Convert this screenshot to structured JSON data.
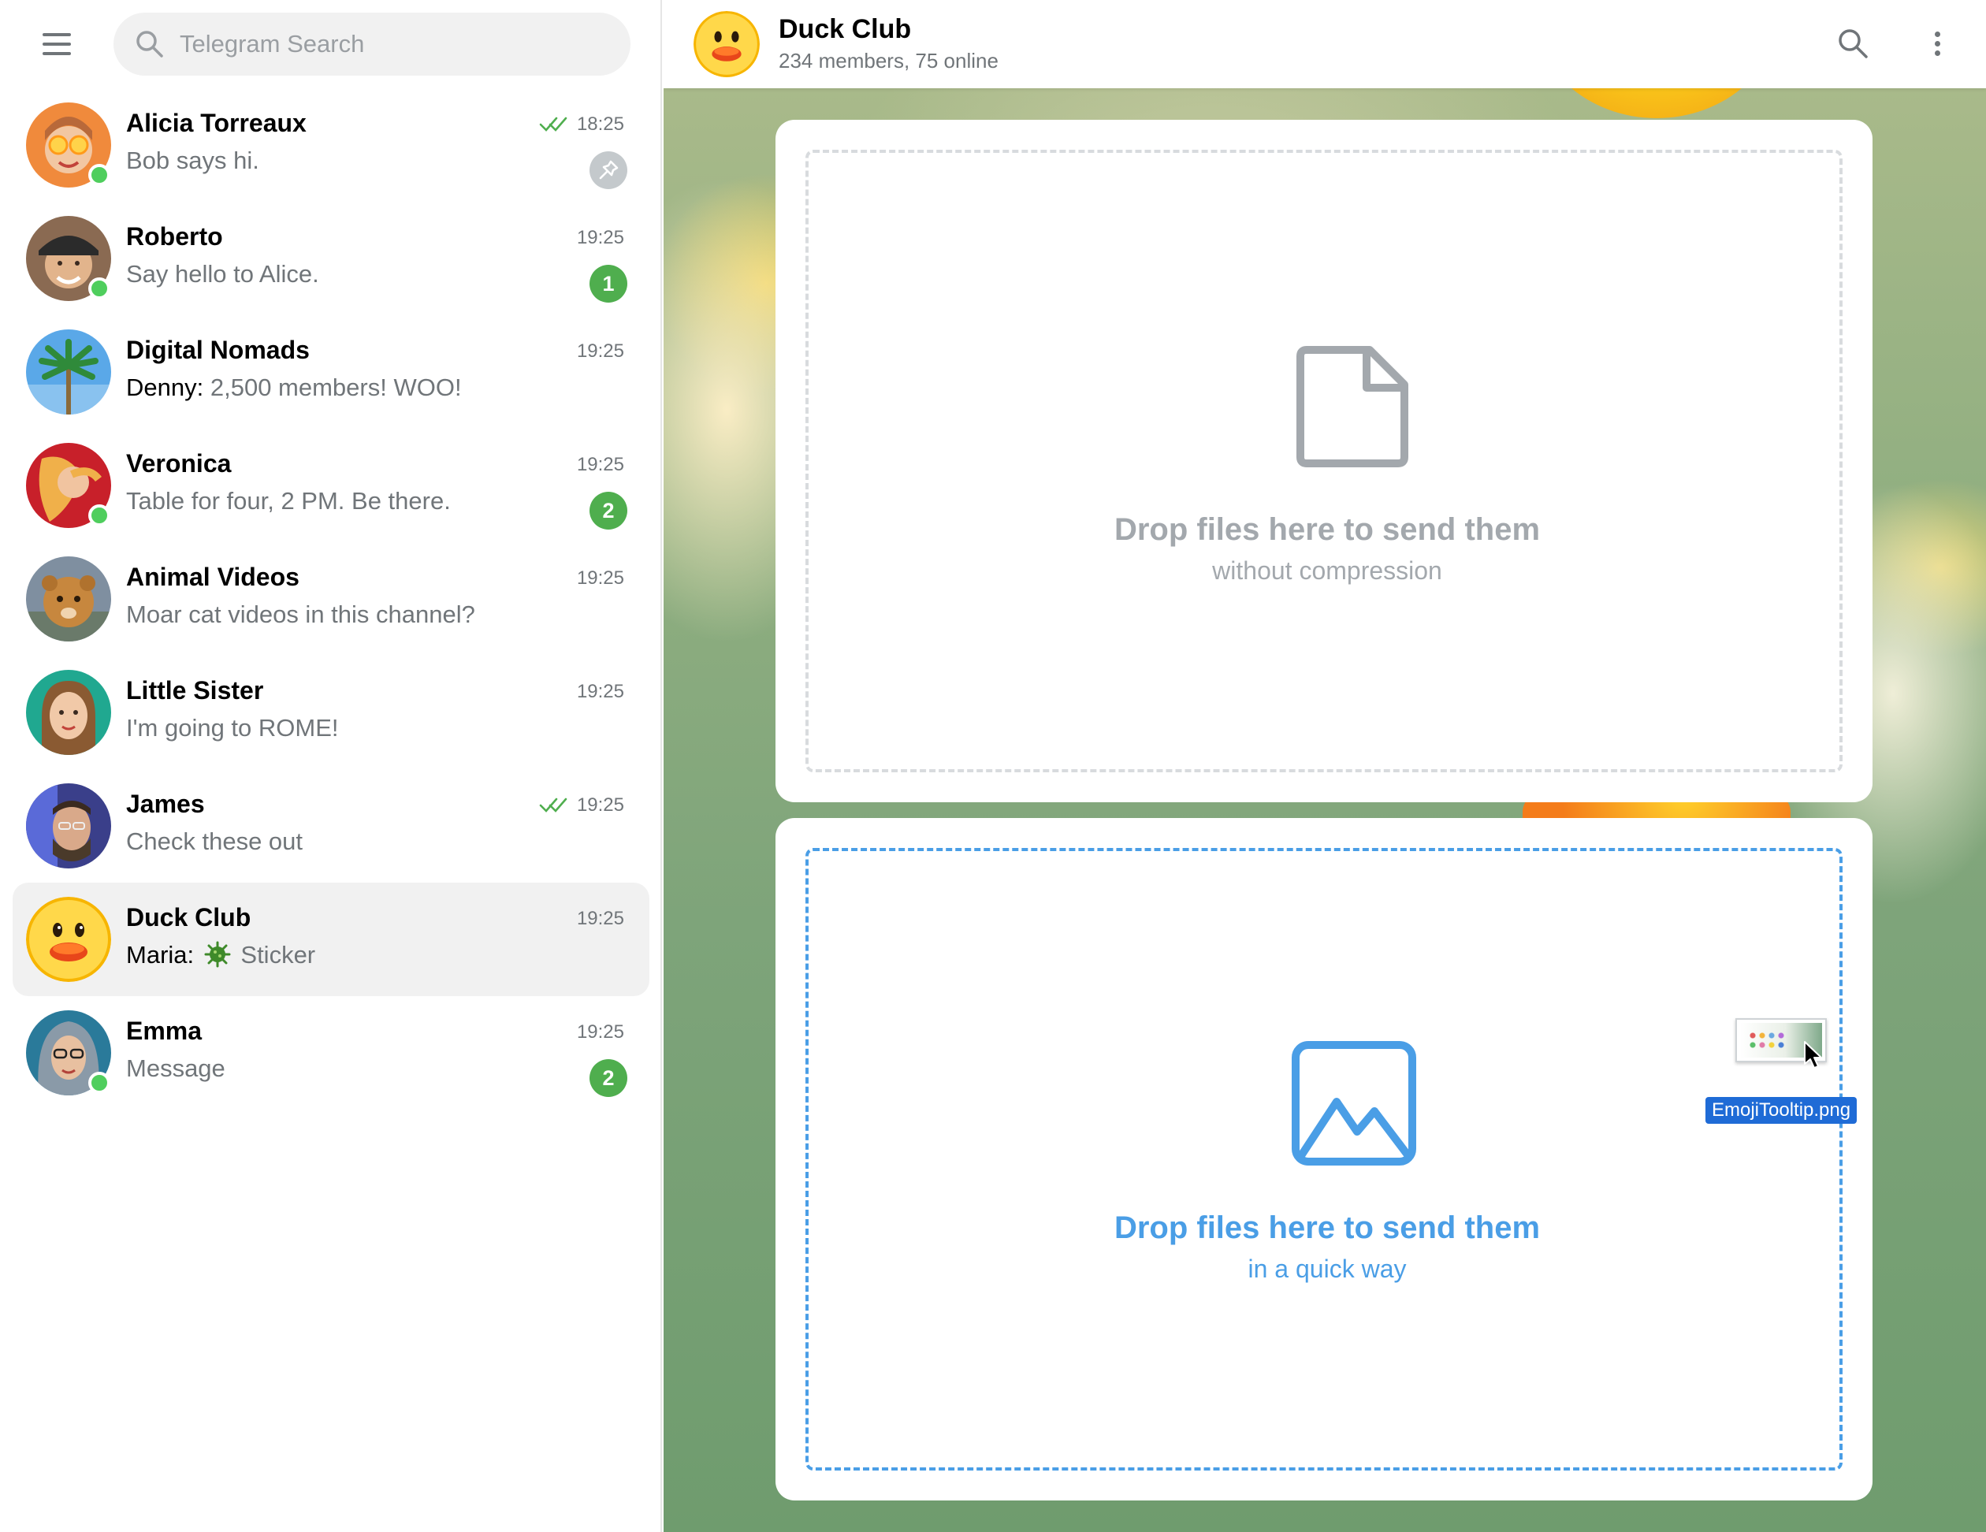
{
  "search": {
    "placeholder": "Telegram Search"
  },
  "chats": [
    {
      "name": "Alicia Torreaux",
      "time": "18:25",
      "preview": "Bob says hi.",
      "online": true,
      "read": true,
      "pinned": true
    },
    {
      "name": "Roberto",
      "time": "19:25",
      "preview": "Say hello to Alice.",
      "online": true,
      "badge": "1"
    },
    {
      "name": "Digital Nomads",
      "time": "19:25",
      "sender": "Denny:",
      "preview": "2,500 members! WOO!"
    },
    {
      "name": "Veronica",
      "time": "19:25",
      "preview": "Table for four, 2 PM. Be there.",
      "online": true,
      "badge": "2"
    },
    {
      "name": "Animal Videos",
      "time": "19:25",
      "preview": "Moar cat videos in this channel?"
    },
    {
      "name": "Little Sister",
      "time": "19:25",
      "preview": "I'm going to ROME!"
    },
    {
      "name": "James",
      "time": "19:25",
      "preview": "Check these out",
      "read": true
    },
    {
      "name": "Duck Club",
      "time": "19:25",
      "sender": "Maria:",
      "preview": "Sticker",
      "active": true
    },
    {
      "name": "Emma",
      "time": "19:25",
      "preview": "Message",
      "online": true,
      "badge": "2"
    }
  ],
  "header": {
    "title": "Duck Club",
    "subtitle": "234 members, 75 online"
  },
  "drop_zones": {
    "files": {
      "title": "Drop files here to send them",
      "subtitle": "without compression"
    },
    "media": {
      "title": "Drop files here to send them",
      "subtitle": "in a quick way"
    }
  },
  "drag": {
    "file_name": "EmojiTooltip.png"
  },
  "icons": {
    "menu": "hamburger-icon",
    "search": "search-icon",
    "more": "more-vertical-icon",
    "file": "file-icon",
    "photo": "photo-icon",
    "pin": "pin-icon",
    "read": "double-check-icon",
    "cursor": "cursor-icon"
  },
  "colors": {
    "accent": "#4a9ee6",
    "online": "#4fce5d",
    "badge": "#4fae4e",
    "muted": "#707579",
    "drag_label": "#1f6bd6"
  }
}
